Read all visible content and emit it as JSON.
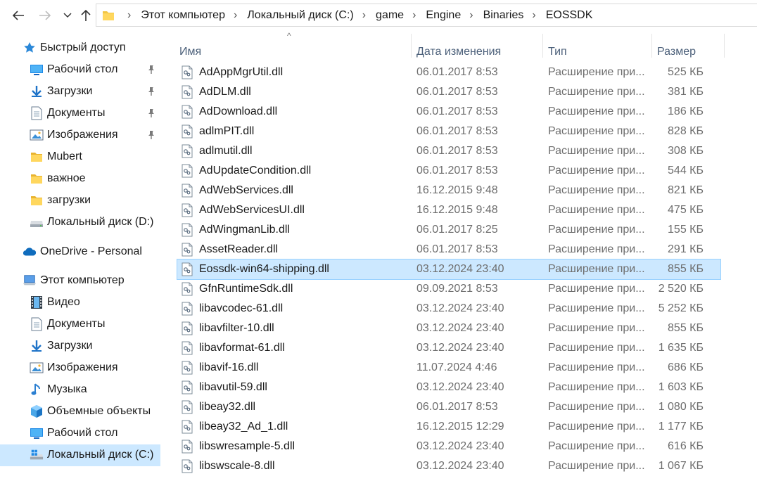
{
  "breadcrumb": [
    "Этот компьютер",
    "Локальный диск (C:)",
    "game",
    "Engine",
    "Binaries",
    "EOSSDK"
  ],
  "sidebar": {
    "items": [
      {
        "label": "Быстрый доступ",
        "icon": "star-icon",
        "pinned": false,
        "selected": false
      },
      {
        "label": "Рабочий стол",
        "icon": "desktop-icon",
        "pinned": true,
        "selected": false
      },
      {
        "label": "Загрузки",
        "icon": "download-arrow-icon",
        "pinned": true,
        "selected": false
      },
      {
        "label": "Документы",
        "icon": "documents-icon",
        "pinned": true,
        "selected": false
      },
      {
        "label": "Изображения",
        "icon": "pictures-icon",
        "pinned": true,
        "selected": false
      },
      {
        "label": "Mubert",
        "icon": "folder-icon",
        "pinned": false,
        "selected": false
      },
      {
        "label": "важное",
        "icon": "folder-icon",
        "pinned": false,
        "selected": false
      },
      {
        "label": "загрузки",
        "icon": "folder-icon",
        "pinned": false,
        "selected": false
      },
      {
        "label": "Локальный диск (D:)",
        "icon": "drive-icon",
        "pinned": false,
        "selected": false
      },
      {
        "label": "OneDrive - Personal",
        "icon": "cloud-icon",
        "pinned": false,
        "selected": false
      },
      {
        "label": "Этот компьютер",
        "icon": "computer-icon",
        "pinned": false,
        "selected": false
      },
      {
        "label": "Видео",
        "icon": "video-icon",
        "pinned": false,
        "selected": false
      },
      {
        "label": "Документы",
        "icon": "documents-icon",
        "pinned": false,
        "selected": false
      },
      {
        "label": "Загрузки",
        "icon": "download-arrow-icon",
        "pinned": false,
        "selected": false
      },
      {
        "label": "Изображения",
        "icon": "pictures-icon",
        "pinned": false,
        "selected": false
      },
      {
        "label": "Музыка",
        "icon": "music-icon",
        "pinned": false,
        "selected": false
      },
      {
        "label": "Объемные объекты",
        "icon": "3d-objects-icon",
        "pinned": false,
        "selected": false
      },
      {
        "label": "Рабочий стол",
        "icon": "desktop-icon",
        "pinned": false,
        "selected": false
      },
      {
        "label": "Локальный диск (C:)",
        "icon": "windows-drive-icon",
        "pinned": false,
        "selected": true
      }
    ]
  },
  "columns": {
    "name": "Имя",
    "date": "Дата изменения",
    "type": "Тип",
    "size": "Размер"
  },
  "files": [
    {
      "name": "AdAppMgrUtil.dll",
      "date": "06.01.2017 8:53",
      "type": "Расширение при...",
      "size": "525 КБ",
      "selected": false
    },
    {
      "name": "AdDLM.dll",
      "date": "06.01.2017 8:53",
      "type": "Расширение при...",
      "size": "381 КБ",
      "selected": false
    },
    {
      "name": "AdDownload.dll",
      "date": "06.01.2017 8:53",
      "type": "Расширение при...",
      "size": "186 КБ",
      "selected": false
    },
    {
      "name": "adlmPIT.dll",
      "date": "06.01.2017 8:53",
      "type": "Расширение при...",
      "size": "828 КБ",
      "selected": false
    },
    {
      "name": "adlmutil.dll",
      "date": "06.01.2017 8:53",
      "type": "Расширение при...",
      "size": "308 КБ",
      "selected": false
    },
    {
      "name": "AdUpdateCondition.dll",
      "date": "06.01.2017 8:53",
      "type": "Расширение при...",
      "size": "544 КБ",
      "selected": false
    },
    {
      "name": "AdWebServices.dll",
      "date": "16.12.2015 9:48",
      "type": "Расширение при...",
      "size": "821 КБ",
      "selected": false
    },
    {
      "name": "AdWebServicesUI.dll",
      "date": "16.12.2015 9:48",
      "type": "Расширение при...",
      "size": "475 КБ",
      "selected": false
    },
    {
      "name": "AdWingmanLib.dll",
      "date": "06.01.2017 8:25",
      "type": "Расширение при...",
      "size": "155 КБ",
      "selected": false
    },
    {
      "name": "AssetReader.dll",
      "date": "06.01.2017 8:53",
      "type": "Расширение при...",
      "size": "291 КБ",
      "selected": false
    },
    {
      "name": "Eossdk-win64-shipping.dll",
      "date": "03.12.2024 23:40",
      "type": "Расширение при...",
      "size": "855 КБ",
      "selected": true
    },
    {
      "name": "GfnRuntimeSdk.dll",
      "date": "09.09.2021 8:53",
      "type": "Расширение при...",
      "size": "2 520 КБ",
      "selected": false
    },
    {
      "name": "libavcodec-61.dll",
      "date": "03.12.2024 23:40",
      "type": "Расширение при...",
      "size": "5 252 КБ",
      "selected": false
    },
    {
      "name": "libavfilter-10.dll",
      "date": "03.12.2024 23:40",
      "type": "Расширение при...",
      "size": "855 КБ",
      "selected": false
    },
    {
      "name": "libavformat-61.dll",
      "date": "03.12.2024 23:40",
      "type": "Расширение при...",
      "size": "1 635 КБ",
      "selected": false
    },
    {
      "name": "libavif-16.dll",
      "date": "11.07.2024 4:46",
      "type": "Расширение при...",
      "size": "686 КБ",
      "selected": false
    },
    {
      "name": "libavutil-59.dll",
      "date": "03.12.2024 23:40",
      "type": "Расширение при...",
      "size": "1 603 КБ",
      "selected": false
    },
    {
      "name": "libeay32.dll",
      "date": "06.01.2017 8:53",
      "type": "Расширение при...",
      "size": "1 080 КБ",
      "selected": false
    },
    {
      "name": "libeay32_Ad_1.dll",
      "date": "16.12.2015 12:29",
      "type": "Расширение при...",
      "size": "1 177 КБ",
      "selected": false
    },
    {
      "name": "libswresample-5.dll",
      "date": "03.12.2024 23:40",
      "type": "Расширение при...",
      "size": "616 КБ",
      "selected": false
    },
    {
      "name": "libswscale-8.dll",
      "date": "03.12.2024 23:40",
      "type": "Расширение при...",
      "size": "1 067 КБ",
      "selected": false
    }
  ],
  "colors": {
    "selection": "#cce8ff",
    "selection_border": "#99d1ff",
    "header_text": "#4c607a",
    "secondary_text": "#6d6d6d"
  }
}
